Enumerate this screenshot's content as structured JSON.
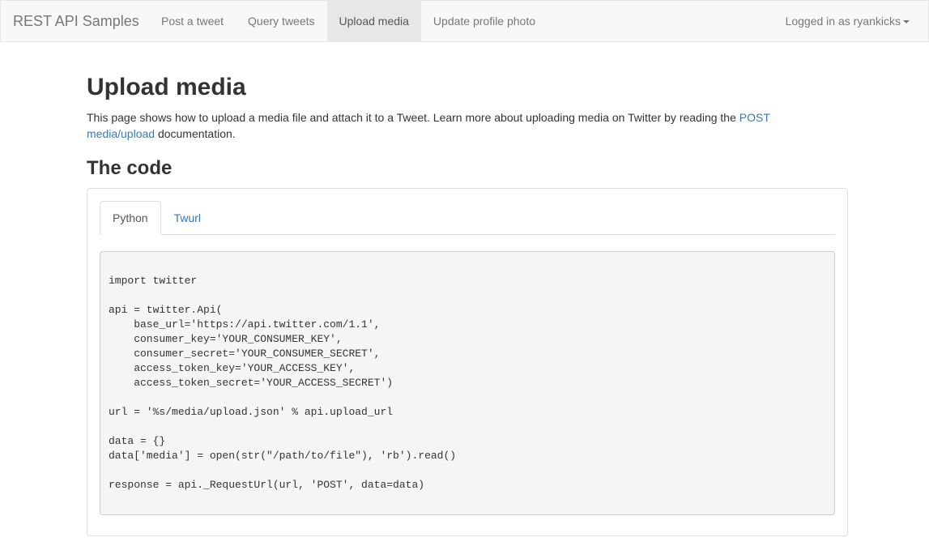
{
  "navbar": {
    "brand": "REST API Samples",
    "links": [
      {
        "label": "Post a tweet",
        "active": false
      },
      {
        "label": "Query tweets",
        "active": false
      },
      {
        "label": "Upload media",
        "active": true
      },
      {
        "label": "Update profile photo",
        "active": false
      }
    ],
    "user_label": "Logged in as ryankicks"
  },
  "page": {
    "title": "Upload media",
    "intro_text": "This page shows how to upload a media file and attach it to a Tweet. Learn more about uploading media on Twitter by reading the ",
    "intro_link": "POST media/upload",
    "intro_suffix": " documentation.",
    "section_title": "The code"
  },
  "code_tabs": [
    {
      "label": "Python",
      "active": true
    },
    {
      "label": "Twurl",
      "active": false
    }
  ],
  "code": {
    "python": "import twitter\n\napi = twitter.Api(\n    base_url='https://api.twitter.com/1.1',\n    consumer_key='YOUR_CONSUMER_KEY',\n    consumer_secret='YOUR_CONSUMER_SECRET',\n    access_token_key='YOUR_ACCESS_KEY',\n    access_token_secret='YOUR_ACCESS_SECRET')\n\nurl = '%s/media/upload.json' % api.upload_url\n\ndata = {}\ndata['media'] = open(str(\"/path/to/file\"), 'rb').read()\n\nresponse = api._RequestUrl(url, 'POST', data=data)"
  },
  "colors": {
    "link": "#337ab7",
    "navbar_bg": "#f8f8f8",
    "active_nav_bg": "#e7e7e7",
    "code_bg": "#f5f5f5"
  }
}
